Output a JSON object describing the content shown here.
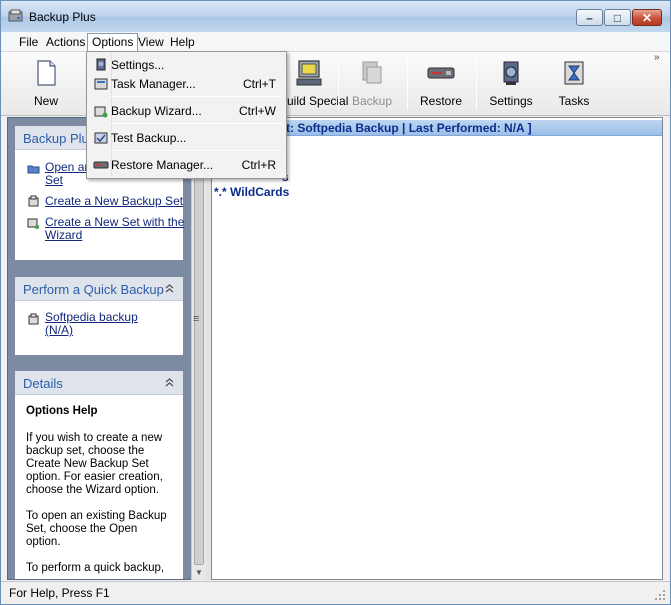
{
  "window": {
    "title": "Backup Plus"
  },
  "menubar": {
    "items": [
      "File",
      "Actions",
      "Options",
      "View",
      "Help"
    ]
  },
  "toolbar": {
    "buttons": [
      {
        "label": "New",
        "icon": "new-document-icon"
      },
      {
        "label": "Build Special",
        "icon": "build-special-icon"
      },
      {
        "label": "Backup",
        "icon": "backup-icon",
        "disabled": true
      },
      {
        "label": "Restore",
        "icon": "restore-icon"
      },
      {
        "label": "Settings",
        "icon": "settings-icon"
      },
      {
        "label": "Tasks",
        "icon": "tasks-icon"
      }
    ],
    "chevron": "»"
  },
  "options_menu": {
    "items": [
      {
        "label": "Settings...",
        "shortcut": ""
      },
      {
        "label": "Task Manager...",
        "shortcut": "Ctrl+T"
      },
      {
        "label": "Backup Wizard...",
        "shortcut": "Ctrl+W"
      },
      {
        "label": "Test Backup...",
        "shortcut": ""
      },
      {
        "label": "Restore Manager...",
        "shortcut": "Ctrl+R"
      }
    ]
  },
  "left_pane": {
    "backup_panel": {
      "title": "Backup Plus",
      "links": [
        {
          "line1": "Open an",
          "line2": "Set"
        },
        {
          "line1": "Create a New Backup Set",
          "line2": ""
        },
        {
          "line1": "Create a New Set with the",
          "line2": "Wizard"
        }
      ]
    },
    "quick_panel": {
      "title": "Perform a Quick Backup",
      "links": [
        {
          "line1": "Softpedia backup",
          "line2": "(N/A)"
        }
      ]
    },
    "details_panel": {
      "title": "Details",
      "heading": "Options Help",
      "paragraphs": [
        [
          "If you wish to create a new",
          "backup set, choose the",
          "Create New Backup Set",
          "option.  For easier creation,",
          "choose the Wizard option."
        ],
        [
          "To open an existing Backup",
          "Set, choose the Open",
          "option."
        ],
        [
          "To perform a quick backup,"
        ]
      ]
    }
  },
  "right_pane": {
    "header": "t:  Softpedia Backup | Last Performed:  N/A ]",
    "nodes": [
      "s",
      "*.*  WildCards"
    ]
  },
  "statusbar": {
    "text": "For Help, Press F1"
  },
  "colors": {
    "accent": "#2a5ea8",
    "header_text": "#0b2d8c",
    "link": "#12287a"
  }
}
